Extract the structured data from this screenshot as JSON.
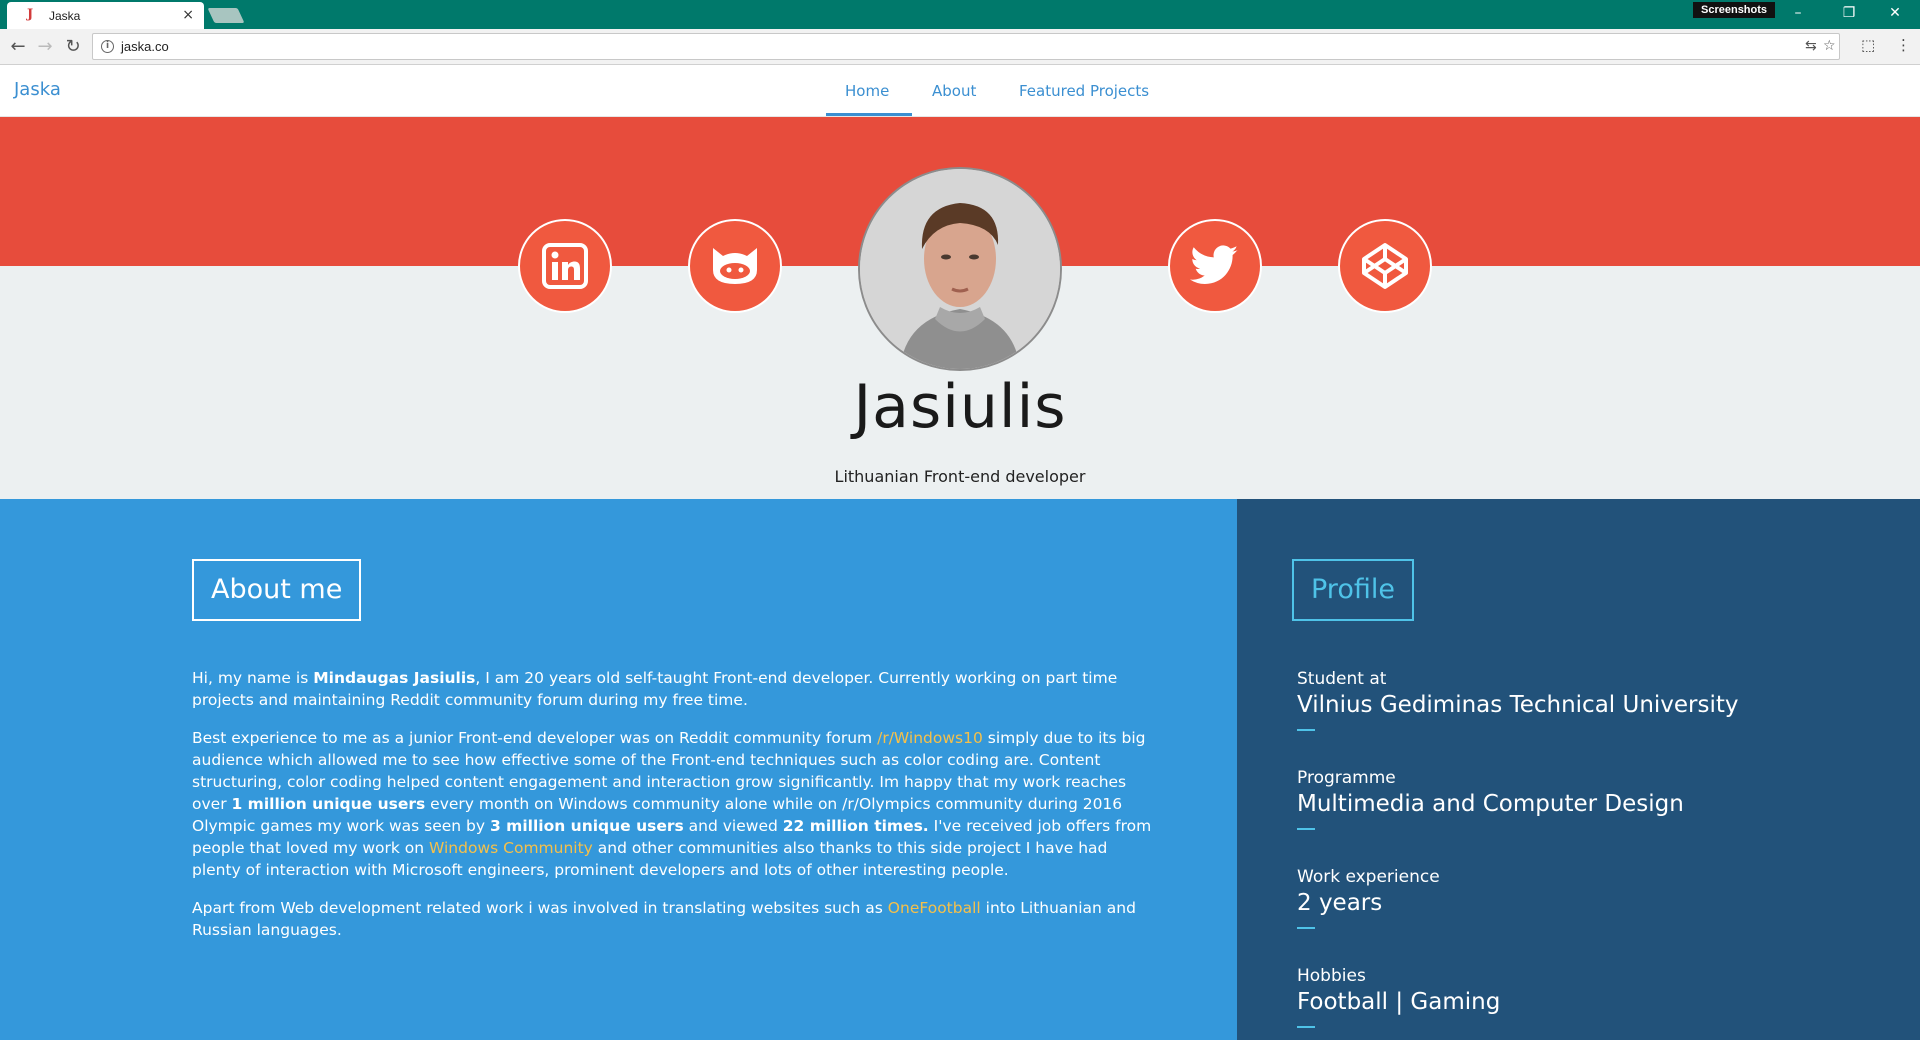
{
  "browser": {
    "tab_title": "Jaska",
    "tab_close": "×",
    "url": "jaska.co",
    "extension_badge": "Screenshots",
    "window_controls": {
      "minimize": "–",
      "restore": "❐",
      "close": "✕"
    }
  },
  "nav": {
    "brand": "Jaska",
    "links": [
      "Home",
      "About",
      "Featured Projects"
    ],
    "active": "Home"
  },
  "hero": {
    "name": "Jasiulis",
    "subtitle": "Lithuanian Front-end developer",
    "social": [
      "linkedin-icon",
      "github-icon",
      "twitter-icon",
      "codepen-icon"
    ]
  },
  "about": {
    "heading": "About me",
    "p1": {
      "t1": "Hi, my name is ",
      "b1": "Mindaugas Jasiulis",
      "t2": ", I am 20 years old self-taught Front-end developer. Currently working on part time projects and maintaining Reddit community forum during my free time."
    },
    "p2": {
      "t1": "Best experience to me as a junior Front-end developer was on Reddit community forum ",
      "link1": "/r/Windows10",
      "t2": " simply due to its big audience which allowed me to see how effective some of the Front-end techniques such as color coding are. Content structuring, color coding helped content engagement and interaction grow significantly. Im happy that my work reaches over ",
      "b1": "1 million unique users",
      "t3": " every month on Windows community alone while on /r/Olympics community during 2016 Olympic games my work was seen by ",
      "b2": "3 million unique users",
      "t4": " and viewed ",
      "b3": "22 million times.",
      "t5": " I've received job offers from people that loved my work on ",
      "link2": "Windows Community",
      "t6": " and other communities also thanks to this side project I have had plenty of interaction with Microsoft engineers, prominent developers and lots of other interesting people."
    },
    "p3": {
      "t1": "Apart from Web development related work i was involved in translating websites such as ",
      "link1": "OneFootball",
      "t2": " into Lithuanian and Russian languages."
    }
  },
  "profile": {
    "heading": "Profile",
    "items": [
      {
        "label": "Student at",
        "value": "Vilnius Gediminas Technical University"
      },
      {
        "label": "Programme",
        "value": "Multimedia and Computer Design"
      },
      {
        "label": "Work experience",
        "value": "2 years"
      },
      {
        "label": "Hobbies",
        "value": "Football | Gaming"
      }
    ]
  },
  "colors": {
    "titlebar": "#00796b",
    "accent_blue": "#3b8fd1",
    "hero_red": "#e74c3c",
    "social_red": "#f0593f",
    "about_bg": "#3498db",
    "profile_bg": "#22527a",
    "profile_accent": "#4fc3e8",
    "link_yellow": "#f5c04a"
  }
}
